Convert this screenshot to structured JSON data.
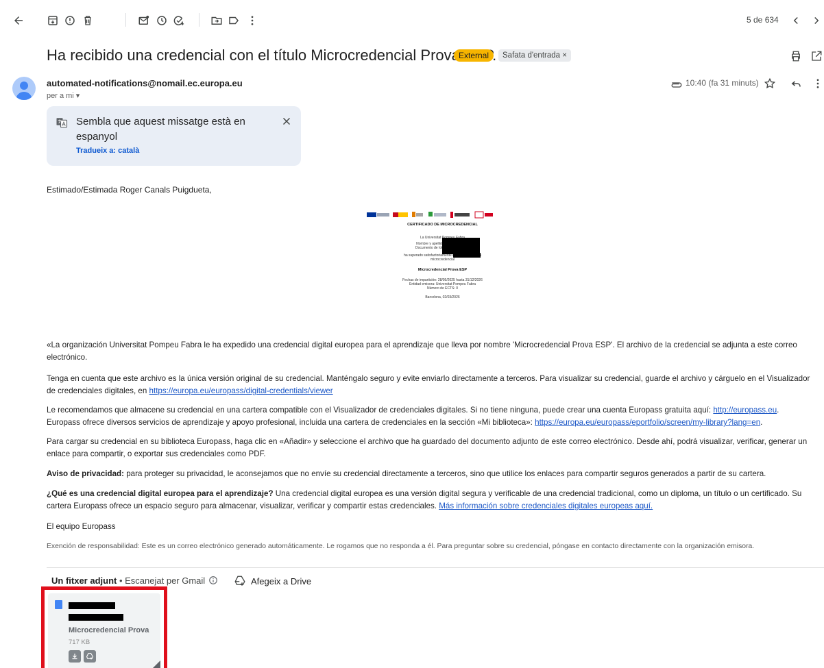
{
  "toolbar": {
    "counter": "5 de 634"
  },
  "subject": "Ha recibido una credencial con el título Microcredencial Prova ESP.",
  "labels": {
    "external": "External",
    "inbox": "Safata d'entrada ×"
  },
  "sender": {
    "email": "automated-notifications@nomail.ec.europa.eu",
    "to": "per a mi ▾",
    "time": "10:40 (fa 31 minuts)"
  },
  "translate": {
    "message": "Sembla que aquest missatge està en espanyol",
    "action": "Tradueix a: català"
  },
  "body": {
    "greeting": "Estimado/Estimada Roger Canals Puigdueta,",
    "p1": "«La organización Universitat Pompeu Fabra le ha expedido una credencial digital europea para el aprendizaje que lleva por nombre 'Microcredencial Prova ESP'. El archivo de la credencial se adjunta a este correo electrónico.",
    "p2_text": "Tenga en cuenta que este archivo es la única versión original de su credencial. Manténgalo seguro y evite enviarlo directamente a terceros. Para visualizar su credencial, guarde el archivo y cárguelo en el Visualizador de credenciales digitales, en ",
    "p2_link": "https://europa.eu/europass/digital-credentials/viewer",
    "p3_text_a": "Le recomendamos que almacene su credencial en una cartera compatible con el Visualizador de credenciales digitales. Si no tiene ninguna, puede crear una cuenta Europass gratuita aquí: ",
    "p3_link_a": "http://europass.eu",
    "p3_text_b": ". Europass ofrece diversos servicios de aprendizaje y apoyo profesional, incluida una cartera de credenciales en la sección «Mi biblioteca»: ",
    "p3_link_b": "https://europa.eu/europass/eportfolio/screen/my-library?lang=en",
    "p3_end": ".",
    "p4": "Para cargar su credencial en su biblioteca Europass, haga clic en «Añadir» y seleccione el archivo que ha guardado del documento adjunto de este correo electrónico. Desde ahí, podrá visualizar, verificar, generar un enlace para compartir, o exportar sus credenciales como PDF.",
    "p5_bold": "Aviso de privacidad:",
    "p5_text": " para proteger su privacidad, le aconsejamos que no envíe su credencial directamente a terceros, sino que utilice los enlaces para compartir seguros generados a partir de su cartera.",
    "p6_bold": "¿Qué es una credencial digital europea para el aprendizaje?",
    "p6_text": " Una credencial digital europea es una versión digital segura y verificable de una credencial tradicional, como un diploma, un título o un certificado. Su cartera Europass ofrece un espacio seguro para almacenar, visualizar, verificar y compartir estas credenciales. ",
    "p6_link": "Más información sobre credenciales digitales europeas aquí.",
    "signoff": "El equipo Europass",
    "disclaimer": "Exención de responsabilidad: Este es un correo electrónico generado automáticamente. Le rogamos que no responda a él. Para preguntar sobre su credencial, póngase en contacto directamente con la organización emisora."
  },
  "certificate": {
    "title": "CERTIFICADO DE MICROCREDENCIAL",
    "line1": "La Universitat Pompeu Fabra",
    "line2": "Nombre y apellidos del estudiante:",
    "line3": "Documento de Identidad (DNI/NIE):",
    "line4": "ha superado satisfactoriamente la acción formativa",
    "line4b": "microcredencial",
    "name": "Microcredencial Prova ESP",
    "dates": "Fechas de impartición: 28/05/2025 hasta 31/12/2026",
    "issuer": "Entidad emisora: Universitat Pompeu Fabra",
    "ects": "Número de ECTS: 0",
    "place": "Barcelona, 02/03/2026"
  },
  "attachments": {
    "count_label": "Un fitxer adjunt",
    "scan_label": "• Escanejat per Gmail",
    "drive_label": "Afegeix a Drive",
    "file_name": "Microcredencial Prova",
    "file_size": "717 KB"
  },
  "colors": {
    "external_chip": "#f7b500",
    "translate_bg": "#e9eef6",
    "link": "#1a56c6",
    "highlight_frame": "#e0101c"
  }
}
